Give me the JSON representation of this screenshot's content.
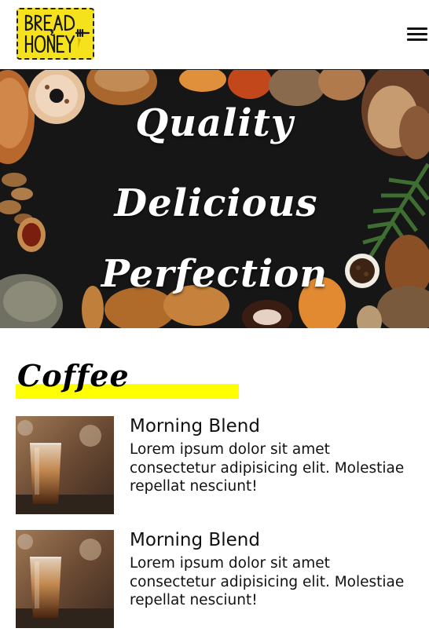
{
  "header": {
    "logo_text": "Bread & Honey",
    "menu_icon": "hamburger-menu-icon"
  },
  "hero": {
    "line1": "Quality",
    "line2": "Delicious",
    "line3": "Perfection"
  },
  "section": {
    "title": "Coffee",
    "highlight_color": "#ffff00"
  },
  "items": [
    {
      "name": "Morning Blend",
      "description": "Lorem ipsum dolor sit amet consectetur adipisicing elit. Molestiae repellat nesciunt!"
    },
    {
      "name": "Morning Blend",
      "description": "Lorem ipsum dolor sit amet consectetur adipisicing elit. Molestiae repellat nesciunt!"
    }
  ]
}
